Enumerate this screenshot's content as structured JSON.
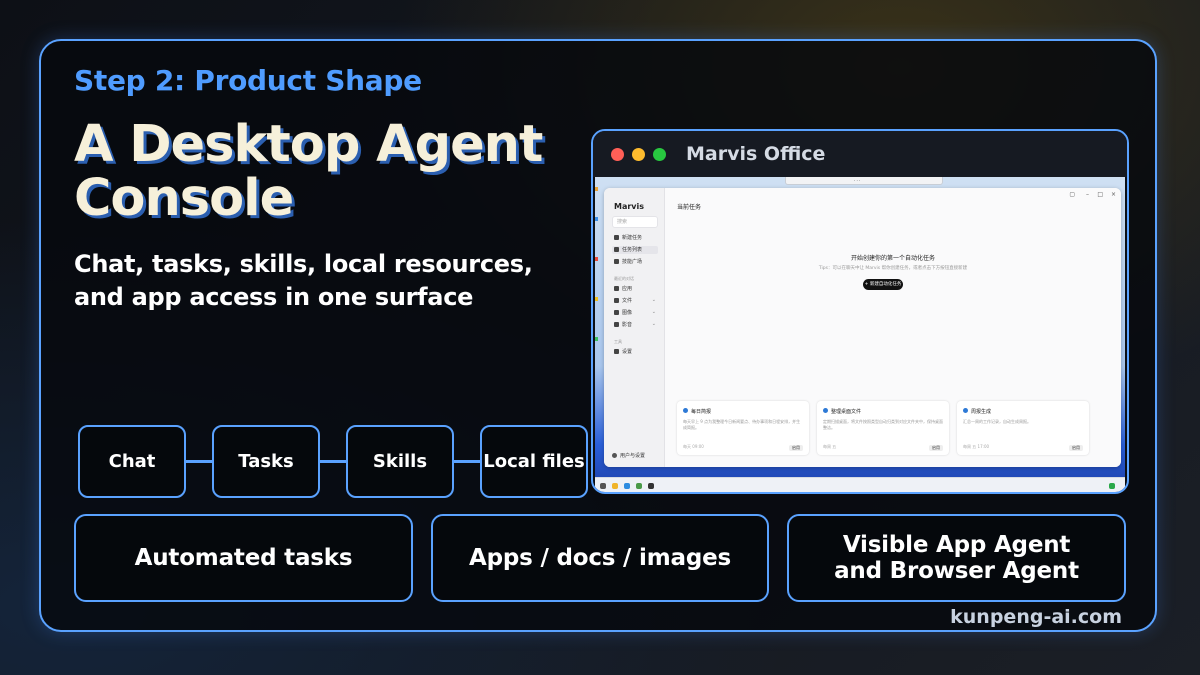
{
  "step_label": "Step 2: Product Shape",
  "headline": [
    "A Desktop Agent",
    "Console"
  ],
  "subtitle": "Chat, tasks, skills, local resources, and app access in one surface",
  "chips": [
    "Chat",
    "Tasks",
    "Skills",
    "Local files"
  ],
  "features": [
    "Automated tasks",
    "Apps / docs / images",
    "Visible App Agent and Browser Agent"
  ],
  "footer": "kunpeng-ai.com",
  "colors": {
    "accent": "#5aa2ff",
    "step_text": "#4f9cff",
    "headline_text": "#f6f0da",
    "headline_shadow": "#2b5fb0"
  },
  "window": {
    "title": "Marvis Office",
    "traffic_lights": [
      "#ff5f57",
      "#febc2e",
      "#28c840"
    ],
    "app": {
      "brand": "Marvis",
      "search_placeholder": "搜索",
      "nav": [
        "新建任务",
        "任务列表",
        "技能广场"
      ],
      "section_label": "最近的对话",
      "groups": [
        "应用",
        "文件",
        "图像",
        "影音"
      ],
      "section2_label": "工具",
      "tool": "设置",
      "user": "用户与设置",
      "main_title": "当前任务",
      "prompt_title": "开始创建你的第一个自动化任务",
      "prompt_tip": "Tips：可以在聊天中让 Marvis 帮你创建任务，或者点击下方按钮直接新建",
      "new_button": "+ 新建自动化任务",
      "cards": [
        {
          "title": "每日简报",
          "desc": "每天早上 9 点为我整理今日新闻要点、待办事项和日程安排，并生成简报。",
          "foot": "每天 09:00",
          "button": "启用"
        },
        {
          "title": "整理桌面文件",
          "desc": "定期扫描桌面，将文件按照类型自动归类到对应文件夹中，保持桌面整洁。",
          "foot": "每周 五",
          "button": "启用"
        },
        {
          "title": "周报生成",
          "desc": "汇总一周的工作记录，自动生成周报。",
          "foot": "每周 五 17:00",
          "button": "启用"
        }
      ]
    }
  }
}
